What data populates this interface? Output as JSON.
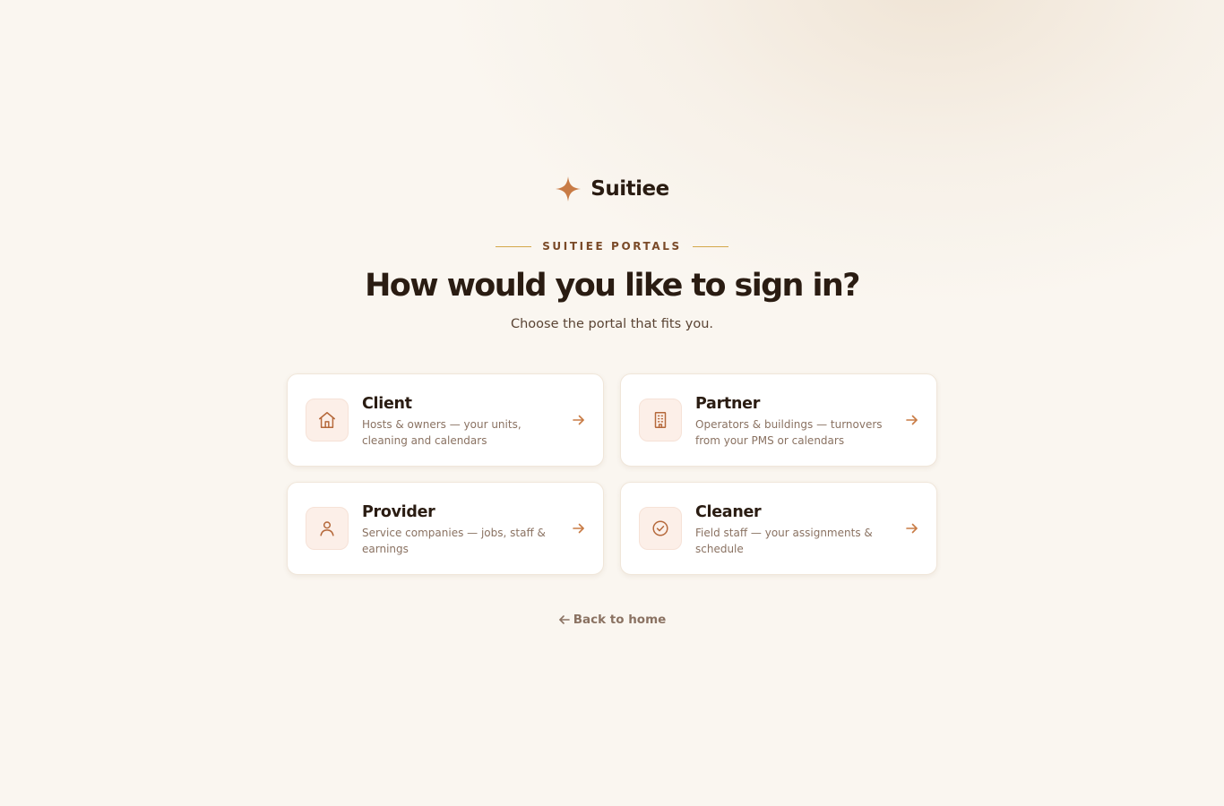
{
  "brand": {
    "name": "Suitiee",
    "icon": "sparkle-icon",
    "accent": "#c87b45"
  },
  "eyebrow": "SUITIEE PORTALS",
  "headline": "How would you like to sign in?",
  "subhead": "Choose the portal that fits you.",
  "portals": [
    {
      "title": "Client",
      "description": "Hosts & owners — your units, cleaning and calendars",
      "icon": "home-icon"
    },
    {
      "title": "Partner",
      "description": "Operators & buildings — turnovers from your PMS or calendars",
      "icon": "building-icon"
    },
    {
      "title": "Provider",
      "description": "Service companies — jobs, staff & earnings",
      "icon": "user-icon"
    },
    {
      "title": "Cleaner",
      "description": "Field staff — your assignments & schedule",
      "icon": "check-circle-icon"
    }
  ],
  "back_link": {
    "label": "Back to home",
    "icon": "arrow-left-icon"
  },
  "colors": {
    "background": "#faf6f0",
    "text": "#2a1c12",
    "muted": "#8a7262",
    "gold_rule": "#d4a84a",
    "icon_tile": "#fcefe8"
  }
}
